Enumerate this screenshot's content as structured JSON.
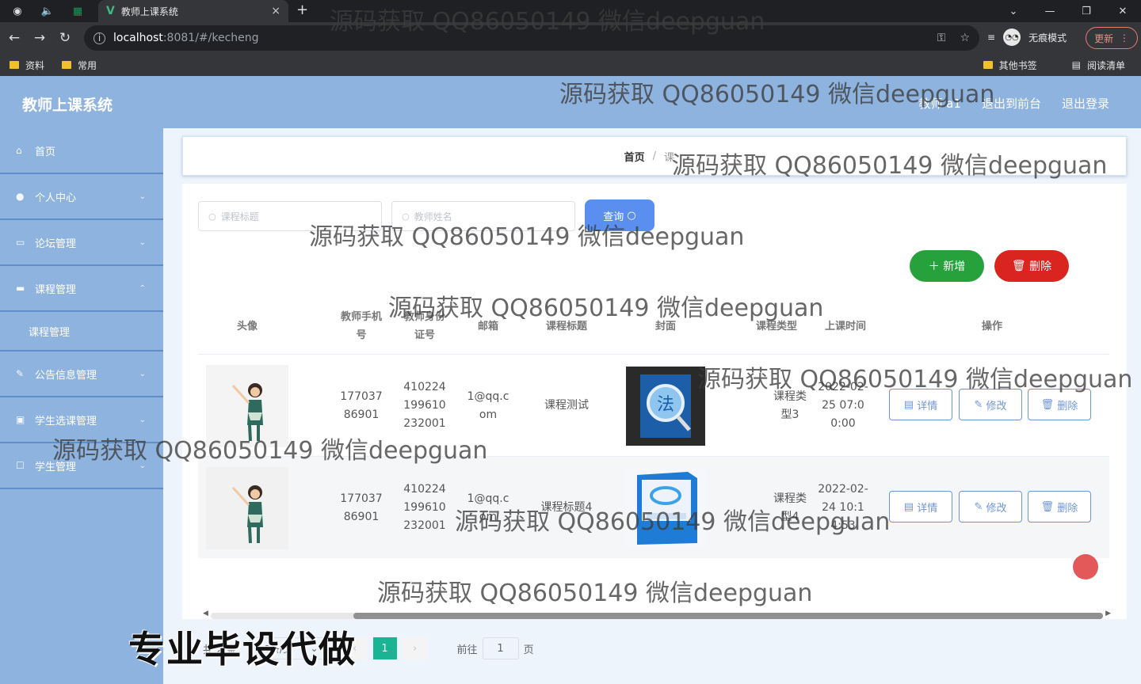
{
  "browser": {
    "tab_title": "教师上课系统",
    "tab_close": "×",
    "new_tab": "+",
    "url_host": "localhost",
    "url_path": ":8081/#/kecheng",
    "incognito_label": "无痕模式",
    "update_label": "更新",
    "bookmarks": [
      "资料",
      "常用"
    ],
    "bookmarks_right": [
      "其他书签",
      "阅读清单"
    ]
  },
  "header": {
    "title": "教师上课系统",
    "user": "教师 a1",
    "to_front": "退出到前台",
    "logout": "退出登录"
  },
  "sidebar": {
    "items": [
      {
        "label": "首页",
        "icon": "home-icon"
      },
      {
        "label": "个人中心",
        "icon": "user-icon"
      },
      {
        "label": "论坛管理",
        "icon": "forum-icon"
      },
      {
        "label": "课程管理",
        "icon": "course-icon"
      },
      {
        "label": "课程管理",
        "icon": ""
      },
      {
        "label": "公告信息管理",
        "icon": "notice-icon"
      },
      {
        "label": "学生选课管理",
        "icon": "select-icon"
      },
      {
        "label": "学生管理",
        "icon": "student-icon"
      }
    ]
  },
  "breadcrumb": {
    "home": "首页",
    "sep": "/",
    "current": "课"
  },
  "search": {
    "course_placeholder": "课程标题",
    "teacher_placeholder": "教师姓名",
    "button": "查询"
  },
  "actions": {
    "add": "新增",
    "delete": "删除"
  },
  "table": {
    "columns": [
      "头像",
      "教师手机号",
      "教师身份证号",
      "邮箱",
      "课程标题",
      "封面",
      "课程类型",
      "上课时间",
      "操作"
    ],
    "rows": [
      {
        "phone": "17703786901",
        "id_card": "410224199610232001",
        "email": "1@qq.com",
        "title": "课程测试",
        "type": "课程类型3",
        "time": "2022-02-25 07:00:00"
      },
      {
        "phone": "17703786901",
        "id_card": "410224199610232001",
        "email": "1@qq.com",
        "title": "课程标题4",
        "type": "课程类型4",
        "time": "2022-02-24 10:14:53"
      }
    ],
    "row_actions": {
      "detail": "详情",
      "edit": "修改",
      "delete": "删除"
    }
  },
  "pagination": {
    "total": "共 2 条",
    "page_size": "10条/页",
    "current_page": "1",
    "goto": "前往",
    "goto_value": "1",
    "page_unit": "页"
  },
  "overlay": {
    "watermark": "源码获取 QQ86050149 微信deepguan",
    "promo": "专业毕设代做"
  }
}
